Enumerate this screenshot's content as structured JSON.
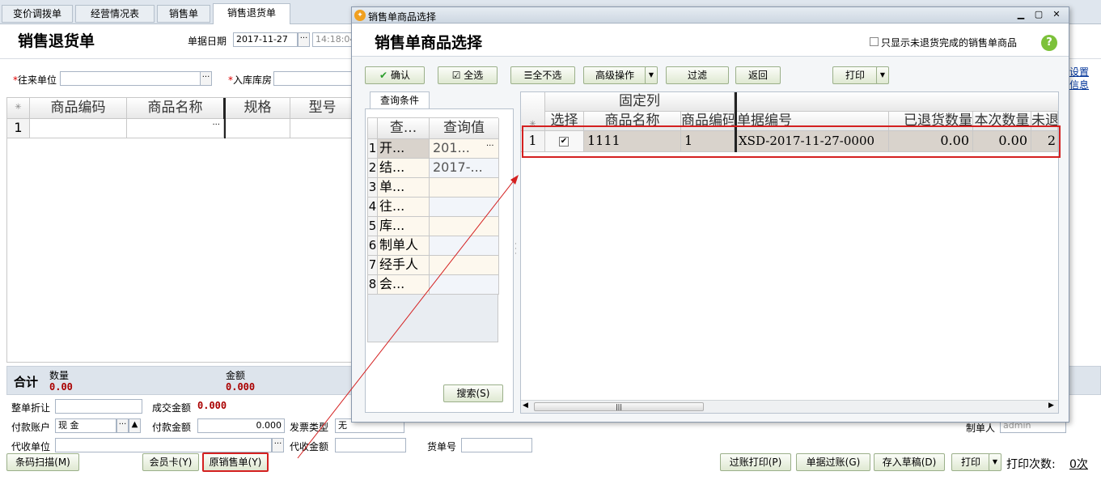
{
  "tabs": [
    "变价调拨单",
    "经营情况表",
    "销售单",
    "销售退货单"
  ],
  "main": {
    "title": "销售退货单",
    "date_label": "单据日期",
    "date_value": "2017-11-27",
    "time_value": "14:18:04",
    "partner_label": "往来单位",
    "warehouse_label": "入库库房",
    "columns": [
      "商品编码",
      "商品名称",
      "规格",
      "型号"
    ],
    "row_num": "1",
    "right_links": [
      "设置",
      "信息"
    ],
    "total_label": "合计",
    "qty_label": "数量",
    "qty_value": "0.00",
    "amount_label": "金额",
    "amount_value": "0.000",
    "discount_label": "整单折让",
    "deal_amount_label": "成交金额",
    "deal_amount_value": "0.000",
    "pay_account_label": "付款账户",
    "pay_account_value": "现  金",
    "pay_amount_label": "付款金额",
    "pay_amount_value": "0.000",
    "invoice_type_label": "发票类型",
    "invoice_type_value": "无",
    "maker_label": "制单人",
    "maker_value": "admin",
    "collect_unit_label": "代收单位",
    "collect_amount_label": "代收金额",
    "cargo_no_label": "货单号",
    "buttons": {
      "barcode": "条码扫描(M)",
      "member": "会员卡(Y)",
      "original": "原销售单(Y)",
      "post_print": "过账打印(P)",
      "post": "单据过账(G)",
      "draft": "存入草稿(D)",
      "print": "打印"
    },
    "print_count_label": "打印次数:",
    "print_count_value": "0次"
  },
  "dialog": {
    "window_title": "销售单商品选择",
    "heading": "销售单商品选择",
    "only_unreturned_label": "只显示未退货完成的销售单商品",
    "toolbar": {
      "confirm": "确认",
      "select_all": "全选",
      "select_none": "全不选",
      "advanced": "高级操作",
      "filter": "过滤",
      "back": "返回",
      "print": "打印"
    },
    "query_tab": "查询条件",
    "query_headers": [
      "查...",
      "查询值"
    ],
    "query_rows": [
      {
        "n": "1",
        "name": "开...",
        "value": "201..."
      },
      {
        "n": "2",
        "name": "结...",
        "value": "2017-..."
      },
      {
        "n": "3",
        "name": "单...",
        "value": ""
      },
      {
        "n": "4",
        "name": "往...",
        "value": ""
      },
      {
        "n": "5",
        "name": "库...",
        "value": ""
      },
      {
        "n": "6",
        "name": "制单人",
        "value": ""
      },
      {
        "n": "7",
        "name": "经手人",
        "value": ""
      },
      {
        "n": "8",
        "name": "会...",
        "value": ""
      }
    ],
    "search_button": "搜索(S)",
    "fixed_col_label": "固定列",
    "result_headers": [
      "选择",
      "商品名称",
      "商品编码",
      "单据编号",
      "已退货数量",
      "本次数量",
      "未退"
    ],
    "result_row": {
      "n": "1",
      "checked": true,
      "name": "1111",
      "code": "1",
      "doc_no": "XSD-2017-11-27-0000",
      "returned_qty": "0.00",
      "this_qty": "0.00",
      "remain": "2"
    }
  },
  "colors": {
    "highlight_red": "#d42020",
    "tab_active": "#ffffff",
    "dialog_border": "#8a99ad",
    "green_accent": "#2a9d2a"
  }
}
